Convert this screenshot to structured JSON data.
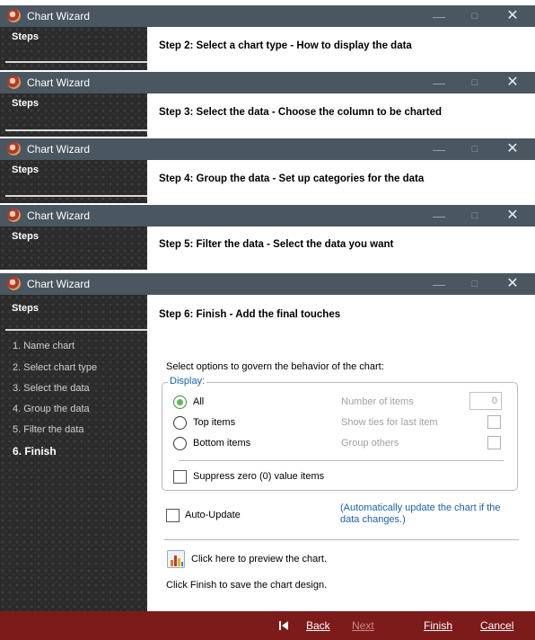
{
  "window_title": "Chart Wizard",
  "window_controls": {
    "minimize": "—",
    "maximize": "□",
    "close": "✕"
  },
  "steps_label": "Steps",
  "panels": [
    {
      "heading": "Step 2: Select a chart type - How to display the data"
    },
    {
      "heading": "Step 3: Select the data - Choose the column to be charted"
    },
    {
      "heading": "Step 4: Group the data - Set up categories for the data"
    },
    {
      "heading": "Step 5: Filter the data - Select the data you want"
    }
  ],
  "main": {
    "heading": "Step 6: Finish - Add the final touches",
    "nav": [
      {
        "label": "1. Name chart",
        "current": false
      },
      {
        "label": "2. Select chart type",
        "current": false
      },
      {
        "label": "3. Select the data",
        "current": false
      },
      {
        "label": "4. Group the data",
        "current": false
      },
      {
        "label": "5. Filter the data",
        "current": false
      },
      {
        "label": "6. Finish",
        "current": true
      }
    ],
    "options_intro": "Select options to govern the behavior of the chart:",
    "display_group": {
      "legend": "Display:",
      "radio_all": "All",
      "radio_top": "Top items",
      "radio_bottom": "Bottom items",
      "selected": "All",
      "number_of_items_label": "Number of items",
      "number_of_items_value": "0",
      "show_ties_label": "Show ties for last item",
      "group_others_label": "Group others",
      "suppress_zero_label": "Suppress zero (0) value items"
    },
    "auto_update_label": "Auto-Update",
    "auto_update_note": "(Automatically update the chart if the data changes.)",
    "preview_link": "Click here to preview the chart.",
    "finish_note": "Click Finish to save the chart design."
  },
  "footer": {
    "back": "Back",
    "next": "Next",
    "finish": "Finish",
    "cancel": "Cancel"
  },
  "colors": {
    "titlebar": "#4a5660",
    "footer": "#7d1a1a",
    "group_legend": "#1a5fb4",
    "radio_selected": "#5cb85c"
  }
}
